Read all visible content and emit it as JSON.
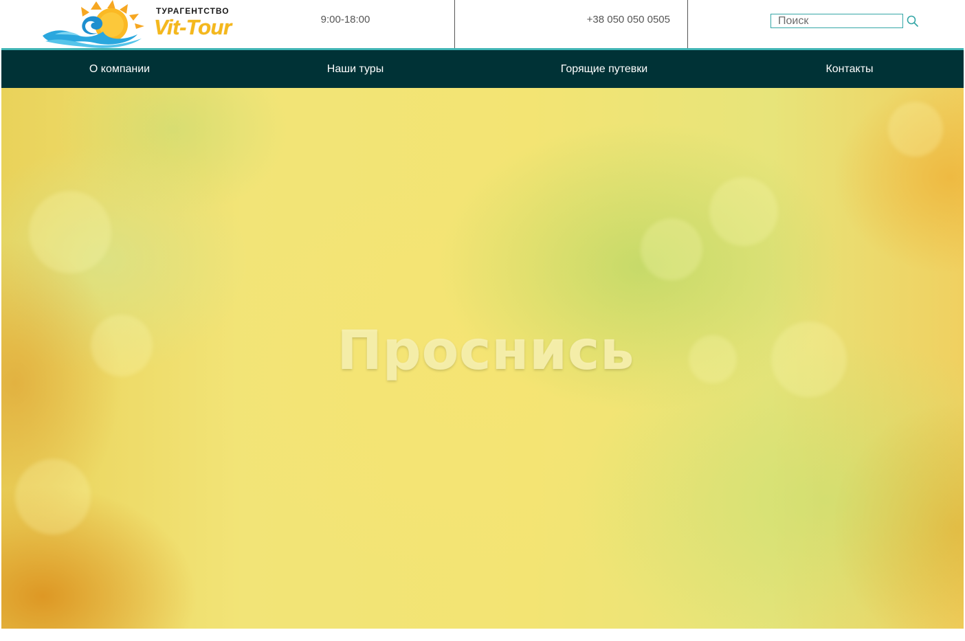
{
  "header": {
    "logo": {
      "caption": "ТУРАГЕНТСТВО",
      "name": "Vit-Tour"
    },
    "hours": "9:00-18:00",
    "phone": "+38 050 050 0505",
    "search": {
      "placeholder": "Поиск",
      "value": ""
    }
  },
  "nav": {
    "items": [
      {
        "label": "О компании"
      },
      {
        "label": "Наши туры"
      },
      {
        "label": "Горящие путевки"
      },
      {
        "label": "Контакты"
      }
    ]
  },
  "hero": {
    "title": "Проснись"
  },
  "colors": {
    "nav_background": "#003236",
    "accent": "#42b5b5",
    "logo_text": "#f4b81c",
    "hero_base": "#f0e472"
  },
  "icons": {
    "search": "magnifier-icon",
    "logo": "sun-waves-logo"
  }
}
